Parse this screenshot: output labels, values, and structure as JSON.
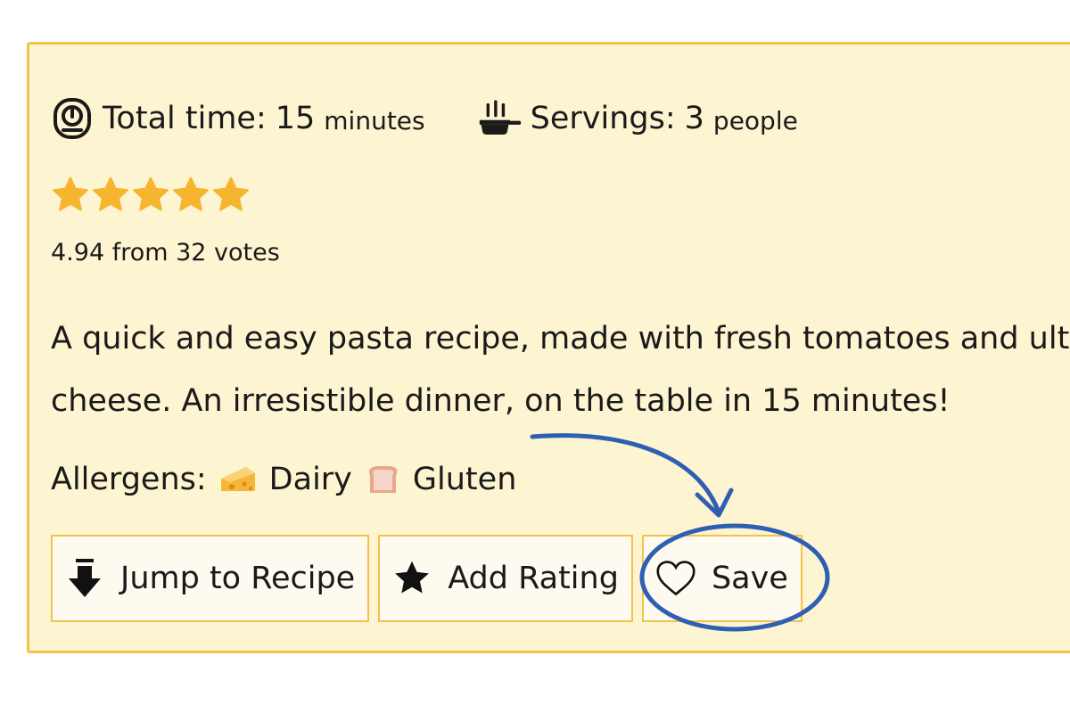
{
  "recipe": {
    "time_label": "Total time:",
    "time_value": "15",
    "time_unit": "minutes",
    "servings_label": "Servings:",
    "servings_value": "3",
    "servings_unit": "people",
    "rating": 4.94,
    "max_rating": 5,
    "rating_text": "4.94 from 32 votes",
    "description_lines": [
      "A quick and easy pasta recipe, made with fresh tomatoes and ultra",
      "cheese. An irresistible dinner, on the table in 15 minutes!"
    ],
    "allergens_label": "Allergens:",
    "allergens": [
      {
        "name": "Dairy",
        "icon": "cheese-icon"
      },
      {
        "name": "Gluten",
        "icon": "bread-icon"
      }
    ]
  },
  "buttons": {
    "jump_label": "Jump to Recipe",
    "rating_label": "Add Rating",
    "save_label": "Save"
  },
  "colors": {
    "card_bg": "#fdf4d2",
    "card_border": "#f4c14a",
    "star": "#f5b52e",
    "annotation": "#2f5fb3"
  }
}
